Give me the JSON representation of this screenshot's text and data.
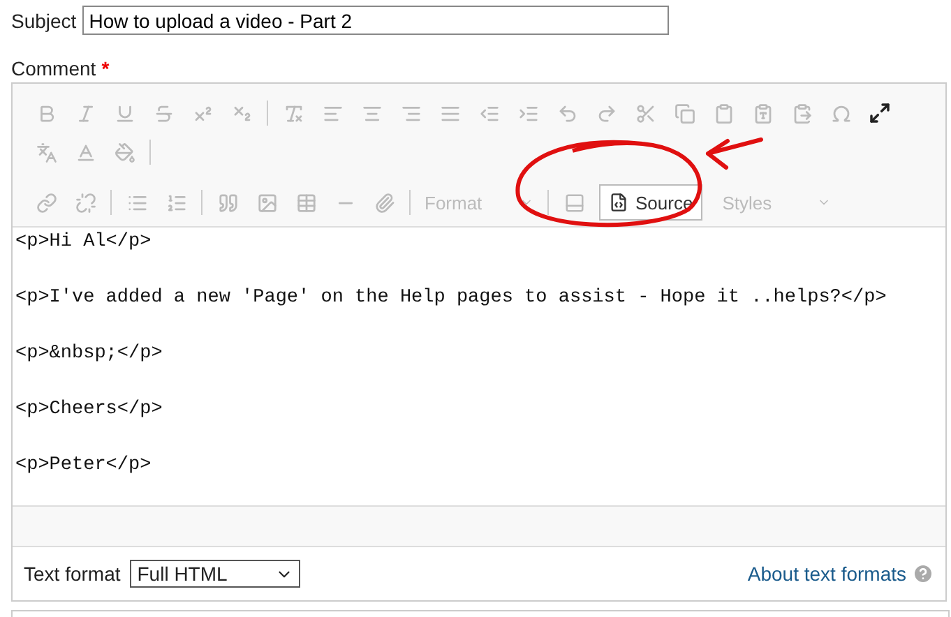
{
  "subject": {
    "label": "Subject",
    "value": "How to upload a video - Part 2"
  },
  "comment": {
    "label": "Comment",
    "required_mark": "*"
  },
  "toolbar": {
    "disabled": true,
    "format_placeholder": "Format",
    "styles_placeholder": "Styles",
    "source_button": {
      "label": "Source",
      "disabled": false
    }
  },
  "source_lines": [
    "<p>Hi Al</p>",
    "<p>I've added a new 'Page' on the Help pages to assist - Hope it ..helps?</p>",
    "<p>&nbsp;</p>",
    "<p>Cheers</p>",
    "<p>Peter</p>"
  ],
  "footer": {
    "label": "Text format",
    "select_value": "Full HTML",
    "help_link": "About text formats"
  }
}
